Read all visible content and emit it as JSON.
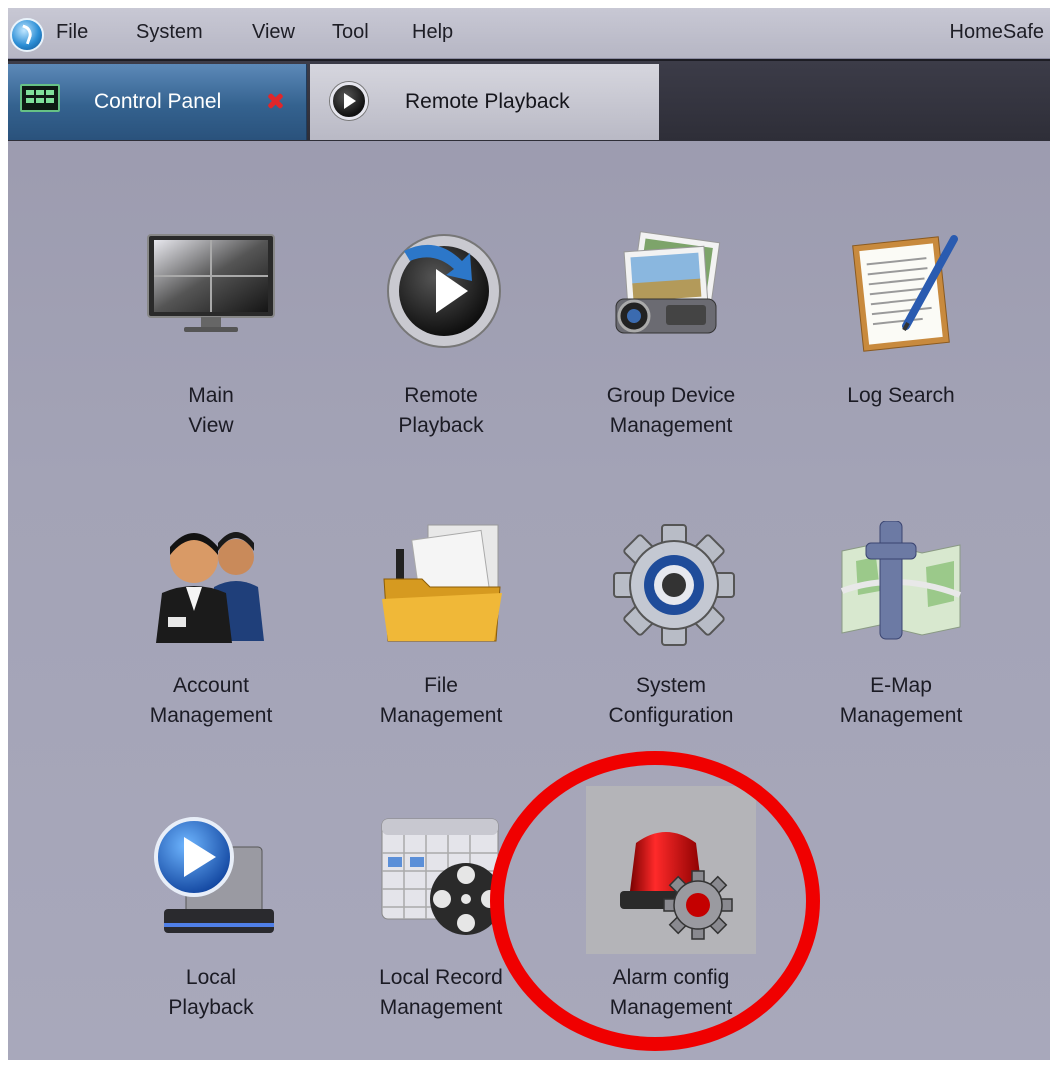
{
  "menu": {
    "items": [
      "File",
      "System",
      "View",
      "Tool",
      "Help"
    ],
    "app_title": "HomeSafe"
  },
  "tabs": [
    {
      "label": "Control Panel",
      "active": true,
      "icon": "monitor-icon"
    },
    {
      "label": "Remote Playback",
      "active": false,
      "icon": "playback-icon"
    }
  ],
  "panel": {
    "tiles": [
      {
        "line1": "Main",
        "line2": "View",
        "icon": "monitor-icon"
      },
      {
        "line1": "Remote",
        "line2": "Playback",
        "icon": "playback-icon"
      },
      {
        "line1": "Group Device",
        "line2": "Management",
        "icon": "camera-photos-icon"
      },
      {
        "line1": "Log Search",
        "line2": "",
        "icon": "notepad-pen-icon"
      },
      {
        "line1": "Account",
        "line2": "Management",
        "icon": "users-icon"
      },
      {
        "line1": "File",
        "line2": "Management",
        "icon": "folder-icon"
      },
      {
        "line1": "System",
        "line2": "Configuration",
        "icon": "gear-icon"
      },
      {
        "line1": "E-Map",
        "line2": "Management",
        "icon": "map-icon"
      },
      {
        "line1": "Local",
        "line2": "Playback",
        "icon": "play-drive-icon"
      },
      {
        "line1": "Local Record",
        "line2": "Management",
        "icon": "calendar-film-icon"
      },
      {
        "line1": "Alarm config",
        "line2": "Management",
        "icon": "alarm-gear-icon"
      }
    ]
  },
  "colors": {
    "annotation_circle": "#f00000",
    "active_tab": "#34628f",
    "panel_background": "#a3a3b6"
  }
}
